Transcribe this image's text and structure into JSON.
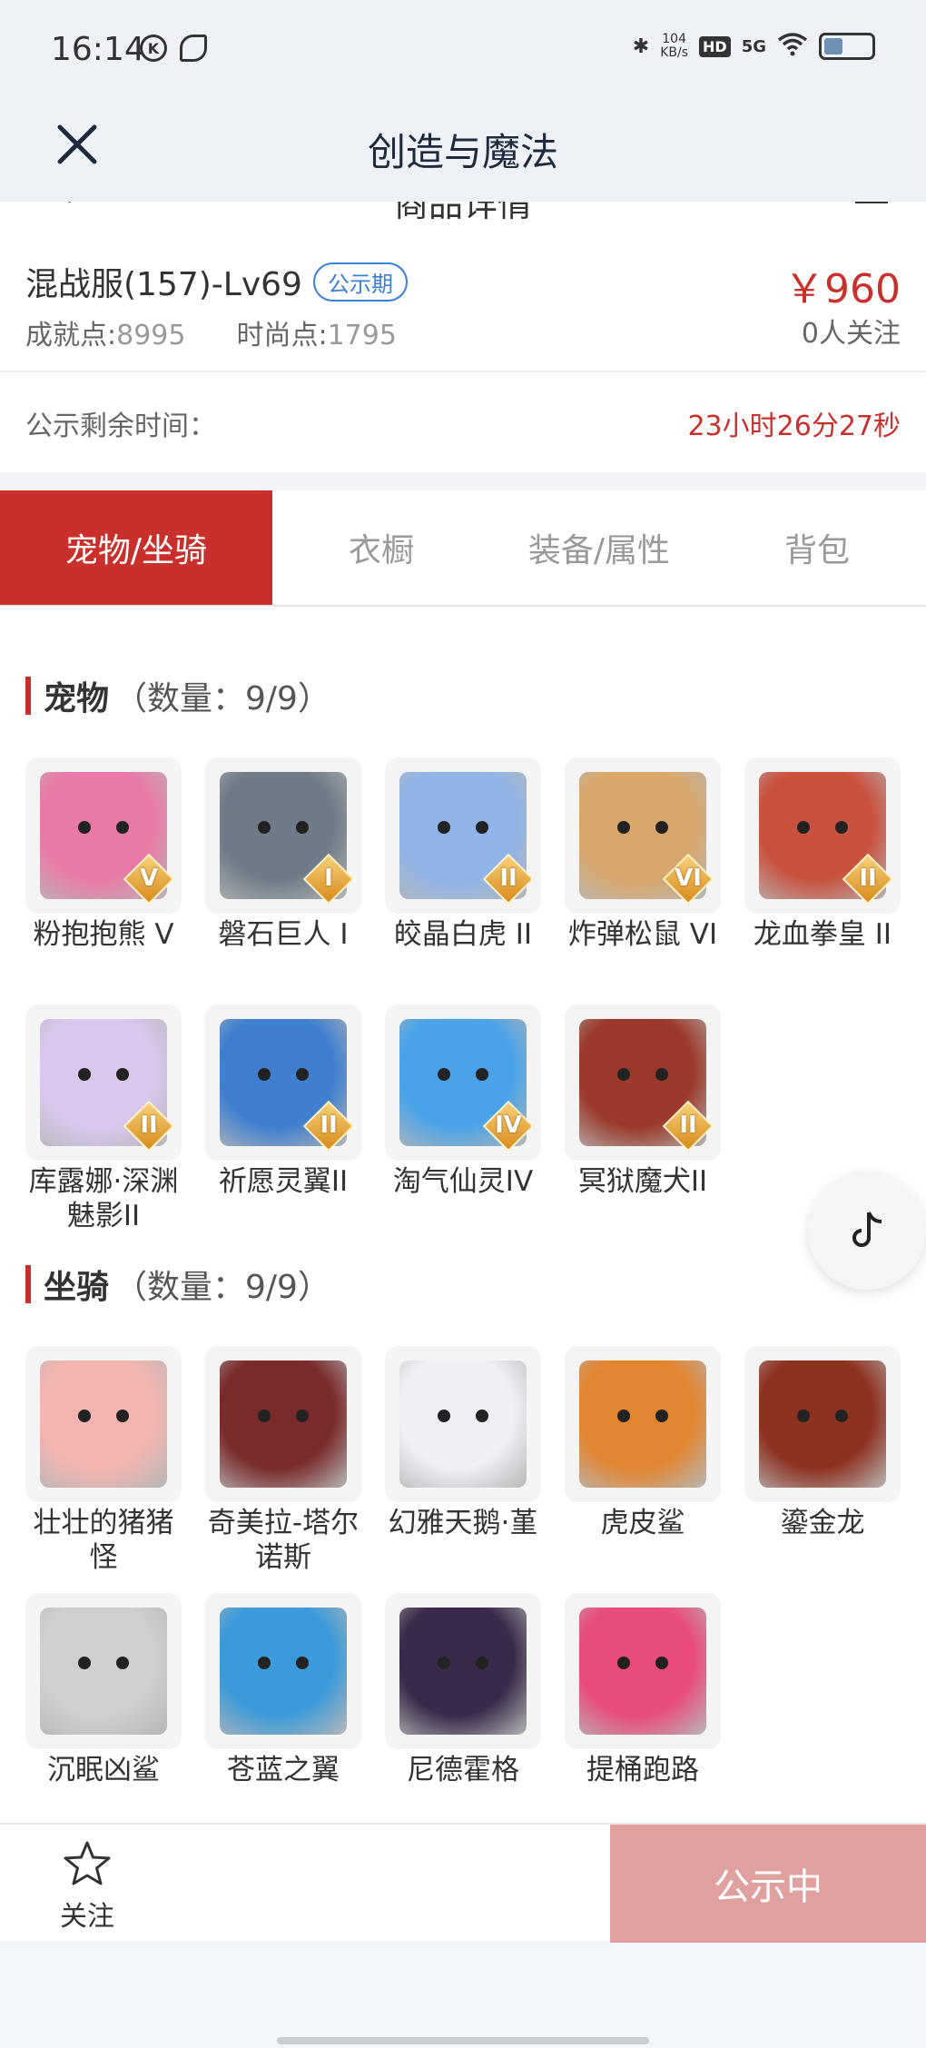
{
  "status": {
    "time": "16:14",
    "speed_value": "104",
    "speed_unit": "KB/s",
    "hd": "HD",
    "network": "5G",
    "battery_percent": 40
  },
  "header": {
    "title": "创造与魔法"
  },
  "sub_header": {
    "title": "商品详情"
  },
  "item": {
    "title": "混战服(157)-Lv69",
    "badge": "公示期",
    "achievement_label": "成就点:",
    "achievement_value": "8995",
    "fashion_label": "时尚点:",
    "fashion_value": "1795",
    "price": "￥960",
    "followers": "0人关注"
  },
  "publicity": {
    "label": "公示剩余时间：",
    "remaining": "23小时26分27秒"
  },
  "tabs": [
    {
      "label": "宠物/坐骑",
      "active": true
    },
    {
      "label": "衣橱"
    },
    {
      "label": "装备/属性"
    },
    {
      "label": "背包"
    }
  ],
  "pets": {
    "title": "宠物",
    "count": "（数量：9/9）",
    "items": [
      {
        "name": "粉抱抱熊 V",
        "rank": "V",
        "color": "#e97aa8",
        "icon": "pink-bear-icon"
      },
      {
        "name": "磐石巨人 I",
        "rank": "I",
        "color": "#6f7b88",
        "icon": "stone-giant-icon"
      },
      {
        "name": "皎晶白虎 II",
        "rank": "II",
        "color": "#8fb4e8",
        "icon": "white-tiger-icon"
      },
      {
        "name": "炸弹松鼠 VI",
        "rank": "VI",
        "color": "#d9a76a",
        "icon": "squirrel-icon"
      },
      {
        "name": "龙血拳皇 II",
        "rank": "II",
        "color": "#c9523f",
        "icon": "dragon-fist-icon"
      },
      {
        "name": "库露娜·深渊魅影II",
        "rank": "II",
        "color": "#d9c7ee",
        "icon": "kuluna-icon"
      },
      {
        "name": "祈愿灵翼II",
        "rank": "II",
        "color": "#3f7fd0",
        "icon": "wish-wing-icon"
      },
      {
        "name": "淘气仙灵IV",
        "rank": "IV",
        "color": "#4aa3e8",
        "icon": "naughty-sprite-icon"
      },
      {
        "name": "冥狱魔犬II",
        "rank": "II",
        "color": "#9b3a2a",
        "icon": "hell-hound-icon"
      }
    ]
  },
  "mounts": {
    "title": "坐骑",
    "count": "（数量：9/9）",
    "items": [
      {
        "name": "壮壮的猪猪怪",
        "color": "#f3b5b0",
        "icon": "pig-icon"
      },
      {
        "name": "奇美拉-塔尔诺斯",
        "color": "#7a2a2a",
        "icon": "chimera-icon"
      },
      {
        "name": "幻雅天鹅·堇",
        "color": "#eef0f6",
        "icon": "swan-icon"
      },
      {
        "name": "虎皮鲨",
        "color": "#e2852f",
        "icon": "tiger-shark-icon"
      },
      {
        "name": "鎏金龙",
        "color": "#8e3220",
        "icon": "gold-dragon-icon"
      },
      {
        "name": "沉眠凶鲨",
        "color": "#cfcfcf",
        "icon": "sleeping-shark-icon"
      },
      {
        "name": "苍蓝之翼",
        "color": "#3b9ad9",
        "icon": "azure-wing-icon"
      },
      {
        "name": "尼德霍格",
        "color": "#3a2a4a",
        "icon": "nidhogg-icon"
      },
      {
        "name": "提桶跑路",
        "color": "#e94b7a",
        "icon": "bucket-icon"
      }
    ]
  },
  "bottom": {
    "follow_label": "关注",
    "status_button": "公示中"
  }
}
